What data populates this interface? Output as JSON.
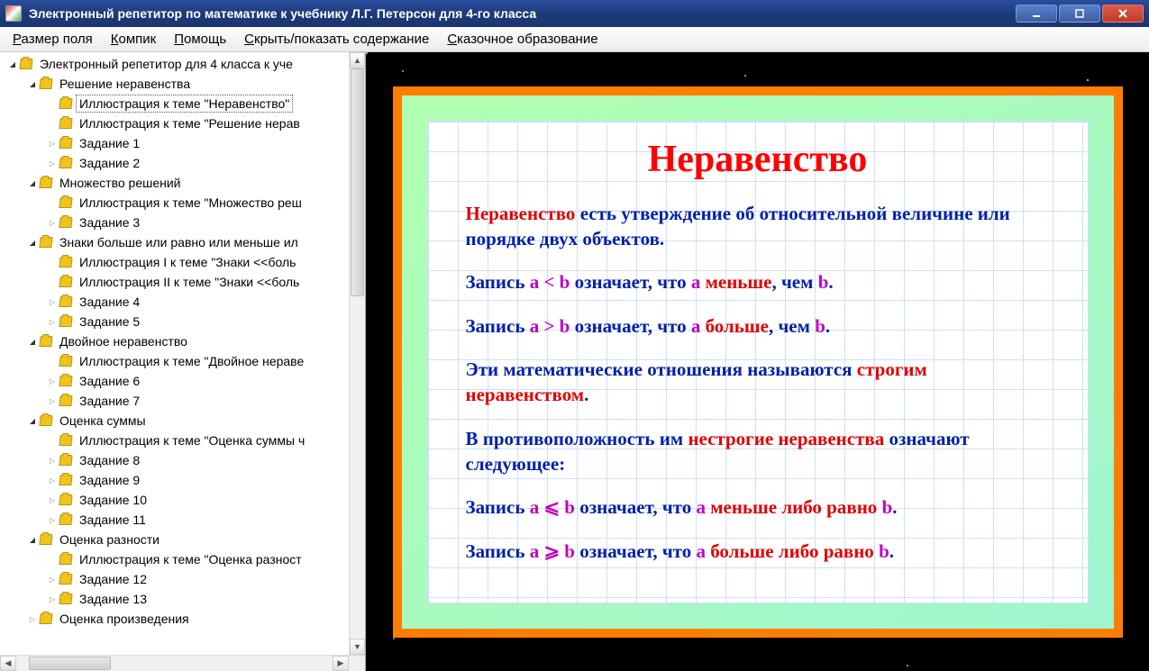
{
  "window": {
    "title": "Электронный репетитор по математике к учебнику Л.Г. Петерсон для 4-го класса"
  },
  "menu": {
    "items": [
      {
        "label": "Размер поля",
        "accel": "Р"
      },
      {
        "label": "Компик",
        "accel": "К"
      },
      {
        "label": "Помощь",
        "accel": "П"
      },
      {
        "label": "Скрыть/показать содержание",
        "accel": "С"
      },
      {
        "label": "Сказочное образование",
        "accel": "С"
      }
    ]
  },
  "tree": {
    "root": "Электронный репетитор для 4 класса к уче",
    "sections": [
      {
        "title": "Решение неравенства",
        "expanded": true,
        "children": [
          {
            "label": "Иллюстрация к теме \"Неравенство\"",
            "leaf": true,
            "selected": true
          },
          {
            "label": "Иллюстрация к теме \"Решение нерав",
            "leaf": true
          },
          {
            "label": "Задание 1",
            "leaf": false,
            "collapsed": true
          },
          {
            "label": "Задание 2",
            "leaf": false,
            "collapsed": true
          }
        ]
      },
      {
        "title": "Множество решений",
        "expanded": true,
        "children": [
          {
            "label": "Иллюстрация к теме \"Множество реш",
            "leaf": true
          },
          {
            "label": "Задание 3",
            "leaf": false,
            "collapsed": true
          }
        ]
      },
      {
        "title": "Знаки больше или равно или меньше ил",
        "expanded": true,
        "children": [
          {
            "label": "Иллюстрация I к теме \"Знаки <<боль",
            "leaf": true
          },
          {
            "label": "Иллюстрация II к теме \"Знаки <<боль",
            "leaf": true
          },
          {
            "label": "Задание 4",
            "leaf": false,
            "collapsed": true
          },
          {
            "label": "Задание 5",
            "leaf": false,
            "collapsed": true
          }
        ]
      },
      {
        "title": "Двойное неравенство",
        "expanded": true,
        "children": [
          {
            "label": "Иллюстрация к теме \"Двойное нераве",
            "leaf": true
          },
          {
            "label": "Задание 6",
            "leaf": false,
            "collapsed": true
          },
          {
            "label": "Задание 7",
            "leaf": false,
            "collapsed": true
          }
        ]
      },
      {
        "title": "Оценка суммы",
        "expanded": true,
        "children": [
          {
            "label": "Иллюстрация к теме \"Оценка суммы ч",
            "leaf": true
          },
          {
            "label": "Задание 8",
            "leaf": false,
            "collapsed": true
          },
          {
            "label": "Задание 9",
            "leaf": false,
            "collapsed": true
          },
          {
            "label": "Задание 10",
            "leaf": false,
            "collapsed": true
          },
          {
            "label": "Задание 11",
            "leaf": false,
            "collapsed": true
          }
        ]
      },
      {
        "title": "Оценка разности",
        "expanded": true,
        "children": [
          {
            "label": "Иллюстрация к теме \"Оценка разност",
            "leaf": true
          },
          {
            "label": "Задание 12",
            "leaf": false,
            "collapsed": true
          },
          {
            "label": "Задание 13",
            "leaf": false,
            "collapsed": true
          }
        ]
      },
      {
        "title": "Оценка произведения",
        "expanded": false,
        "collapsed": true,
        "children": []
      }
    ]
  },
  "slide": {
    "heading": "Неравенство",
    "p1_a": "Неравенство",
    "p1_b": " есть утверждение об относительной ве­личине или порядке двух объектов.",
    "p2_a": "Запись ",
    "p2_b": "a < b",
    "p2_c": " означает, что ",
    "p2_d": "a",
    "p2_e": " меньше",
    "p2_f": ", чем ",
    "p2_g": "b",
    "p2_h": ".",
    "p3_a": "Запись ",
    "p3_b": "a > b",
    "p3_c": " означает, что ",
    "p3_d": "a",
    "p3_e": " больше",
    "p3_f": ", чем ",
    "p3_g": "b",
    "p3_h": ".",
    "p4_a": "Эти математические отношения называются ",
    "p4_b": "строгим неравенством",
    "p4_c": ".",
    "p5_a": "В противоположность им ",
    "p5_b": "нестрогие неравенства",
    "p5_c": " оз­начают следующее:",
    "p6_a": "Запись ",
    "p6_b": "a ⩽ b",
    "p6_c": " означает, что ",
    "p6_d": "a",
    "p6_e": " меньше либо равно ",
    "p6_f": "b",
    "p6_g": ".",
    "p7_a": "Запись ",
    "p7_b": "a ⩾ b",
    "p7_c": " означает, что ",
    "p7_d": "a",
    "p7_e": " больше либо равно ",
    "p7_f": "b",
    "p7_g": "."
  }
}
